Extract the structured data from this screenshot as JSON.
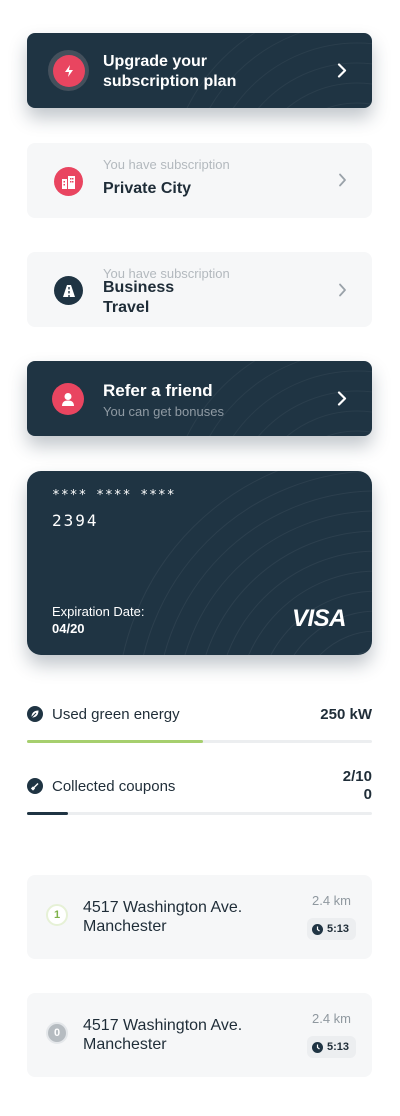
{
  "upgrade_card": {
    "title": "Upgrade your subscription plan",
    "icon": "lightning-icon"
  },
  "subscriptions": [
    {
      "caption": "You have subscription",
      "name": "Private City",
      "icon": "city-icon"
    },
    {
      "caption": "You have subscription",
      "name": "Business Travel",
      "icon": "highway-icon"
    }
  ],
  "refer_card": {
    "title": "Refer a friend",
    "subtitle": "You can get bonuses",
    "icon": "user-icon"
  },
  "payment_card": {
    "masked": "**** **** ****",
    "last_digits": "2394",
    "expiration_label": "Expiration Date:",
    "expiration_value": "04/20",
    "brand": "VISA"
  },
  "metrics": {
    "green_energy": {
      "label": "Used green energy",
      "value": "250 kW",
      "progress": 0.51,
      "icon": "leaf-icon",
      "color": "#a6cf6e"
    },
    "coupons": {
      "label": "Collected coupons",
      "value": "2/10\n0",
      "progress": 0.12,
      "icon": "ticket-icon",
      "color": "#1f3443"
    }
  },
  "stations": [
    {
      "marker": "1",
      "address": "4517 Washington Ave. Manchester",
      "distance": "2.4 km",
      "time": "5:13",
      "marker_color": "#a6cf6e"
    },
    {
      "marker": "0",
      "address": "4517 Washington Ave. Manchester",
      "distance": "2.4 km",
      "time": "5:13",
      "marker_color": "#b6bcc1"
    }
  ],
  "colors": {
    "accent": "#e94560",
    "dark": "#1f3443",
    "green": "#a6cf6e"
  }
}
